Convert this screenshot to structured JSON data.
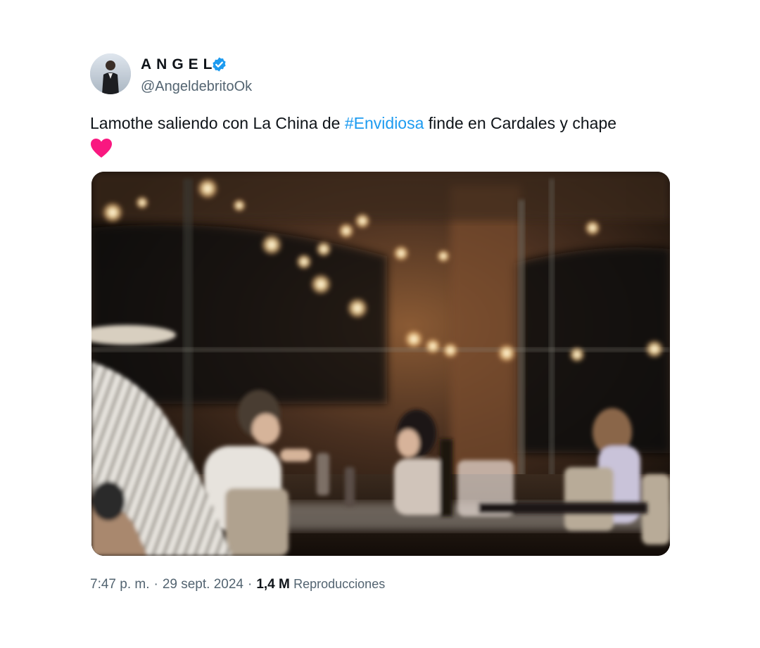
{
  "author": {
    "display_name": "ANGEL",
    "handle": "@AngeldebritoOk",
    "verified": true,
    "avatar_icon": "profile-photo-avatar"
  },
  "tweet": {
    "text_before": "Lamothe saliendo con La China de ",
    "hashtag": "#Envidiosa",
    "text_after": " finde en Cardales y chape",
    "emoji": "red-heart-icon"
  },
  "media": {
    "description_icon": "restaurant-night-photo"
  },
  "footer": {
    "time": "7:47 p. m.",
    "date": "29 sept. 2024",
    "separator": "·",
    "views_count": "1,4 M",
    "views_label": "Reproducciones"
  },
  "colors": {
    "link": "#1d9bf0",
    "verified": "#1d9bf0",
    "heart": "#f91880",
    "muted": "#536471",
    "text": "#0f1419"
  }
}
